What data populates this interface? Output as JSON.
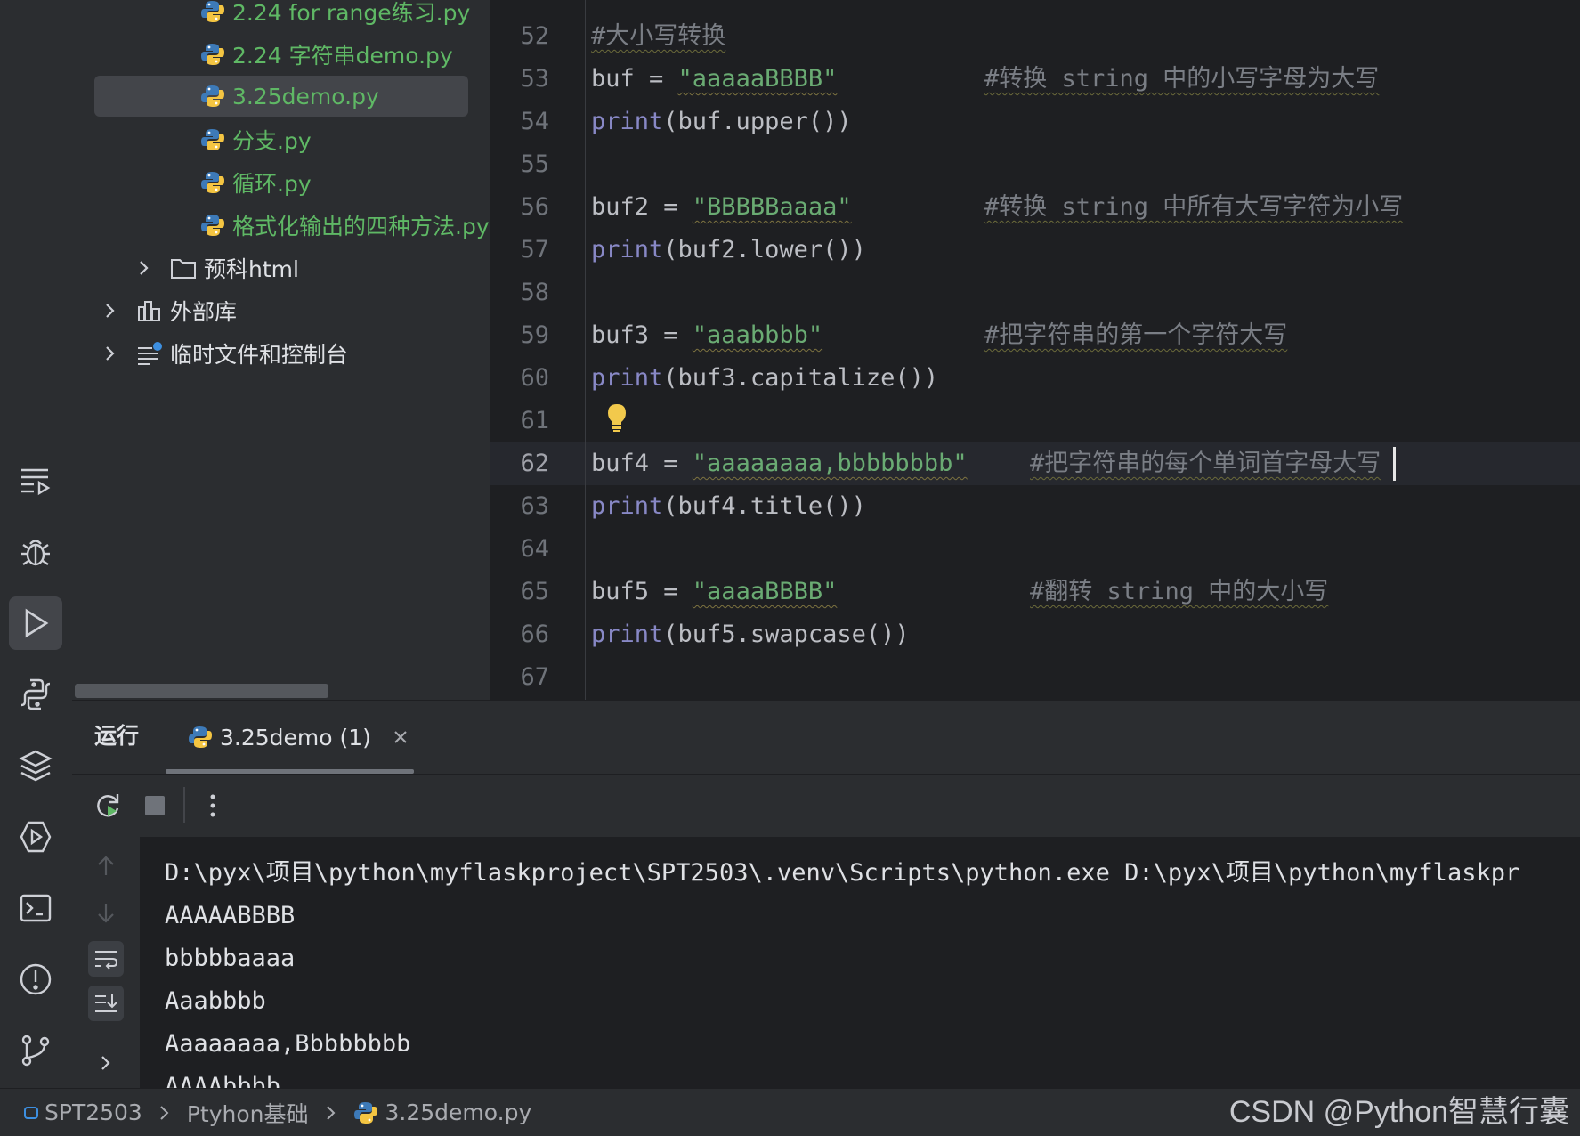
{
  "project_tree": {
    "files": [
      {
        "label": "2.24 for range练习.py",
        "icon": "python-file-icon"
      },
      {
        "label": "2.24 字符串demo.py",
        "icon": "python-file-icon"
      },
      {
        "label": "3.25demo.py",
        "icon": "python-file-icon",
        "selected": true
      },
      {
        "label": "分支.py",
        "icon": "python-file-icon"
      },
      {
        "label": "循环.py",
        "icon": "python-file-icon"
      },
      {
        "label": "格式化输出的四种方法.py",
        "icon": "python-file-icon"
      }
    ],
    "folder": {
      "label": "预科html",
      "icon": "folder-icon"
    },
    "external_libs": {
      "label": "外部库",
      "icon": "library-icon"
    },
    "scratches": {
      "label": "临时文件和控制台",
      "icon": "scratches-icon"
    }
  },
  "editor": {
    "line_numbers": [
      "52",
      "53",
      "54",
      "55",
      "56",
      "57",
      "58",
      "59",
      "60",
      "61",
      "62",
      "63",
      "64",
      "65",
      "66",
      "67"
    ],
    "current_line": "62",
    "lines": {
      "l52": {
        "comment": "#大小写转换"
      },
      "l53": {
        "var": "buf = ",
        "str": "\"aaaaaBBBB\"",
        "comment": "#转换 string 中的小写字母为大写"
      },
      "l54": {
        "fn": "print",
        "rest": "(buf.upper())"
      },
      "l56": {
        "var": "buf2 = ",
        "str": "\"BBBBBaaaa\"",
        "comment": "#转换 string 中所有大写字符为小写"
      },
      "l57": {
        "fn": "print",
        "rest": "(buf2.lower())"
      },
      "l59": {
        "var": "buf3 = ",
        "str": "\"aaabbbb\"",
        "comment": "#把字符串的第一个字符大写"
      },
      "l60": {
        "fn": "print",
        "rest": "(buf3.capitalize())"
      },
      "l62": {
        "var": "buf4 = ",
        "str": "\"aaaaaaaa,bbbbbbbb\"",
        "comment": "#把字符串的每个单词首字母大写"
      },
      "l63": {
        "fn": "print",
        "rest": "(buf4.title())"
      },
      "l65": {
        "var": "buf5 = ",
        "str": "\"aaaaBBBB\"",
        "comment": "#翻转 string 中的大小写"
      },
      "l66": {
        "fn": "print",
        "rest": "(buf5.swapcase())"
      }
    }
  },
  "run_panel": {
    "title": "运行",
    "tab_label": "3.25demo (1)",
    "output": [
      "D:\\pyx\\项目\\python\\myflaskproject\\SPT2503\\.venv\\Scripts\\python.exe D:\\pyx\\项目\\python\\myflaskpr",
      "AAAAABBBB",
      "bbbbbaaaa",
      "Aaabbbb",
      "Aaaaaaaa,Bbbbbbbb",
      "AAAAbbbb"
    ]
  },
  "status_bar": {
    "crumbs": [
      "SPT2503",
      "Ptyhon基础",
      "3.25demo.py"
    ]
  },
  "watermark": "CSDN @Python智慧行囊",
  "colors": {
    "accent_green": "#5fb865",
    "string_green": "#6aab73",
    "function_blue": "#56a8f5",
    "print_purple": "#8888c6",
    "comment_gray": "#7a7e85"
  }
}
